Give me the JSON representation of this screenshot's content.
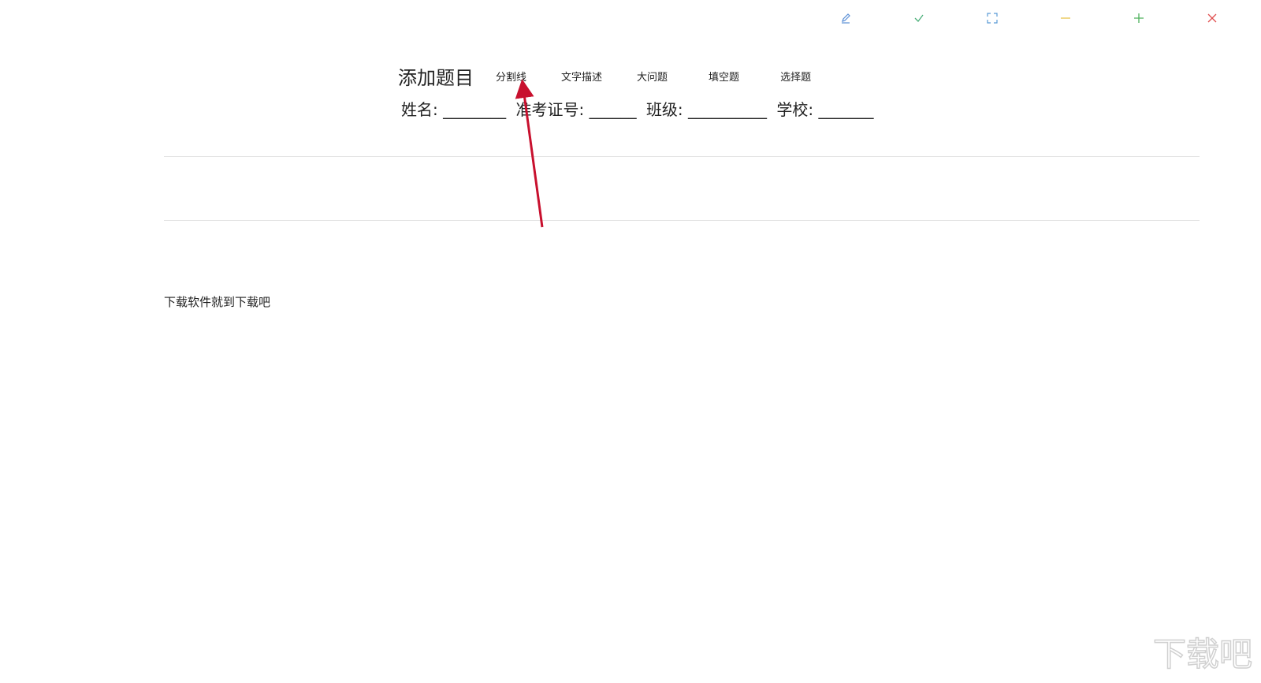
{
  "window_controls": {
    "edit": "pen-icon",
    "confirm": "check-icon",
    "fullscreen": "fullscreen-icon",
    "minimize": "minus-icon",
    "maximize": "plus-icon",
    "close": "close-icon",
    "colors": {
      "edit": "#5b8fd6",
      "confirm": "#4caf7a",
      "fullscreen": "#5b9bd6",
      "minimize": "#e8c34a",
      "maximize": "#4cb05a",
      "close": "#e05050"
    }
  },
  "toolbar": {
    "title": "添加题目",
    "buttons": [
      {
        "label": "分割线"
      },
      {
        "label": "文字描述"
      },
      {
        "label": "大问题"
      },
      {
        "label": "填空题"
      },
      {
        "label": "选择题"
      }
    ]
  },
  "header_info": {
    "name": "姓名: ________",
    "exam_id": "准考证号: ______",
    "class": "班级: __________",
    "school": "学校: _______"
  },
  "content": {
    "description": "下载软件就到下载吧"
  },
  "annotation": {
    "arrow_color": "#c8102e"
  },
  "watermark": {
    "text": "下载吧"
  }
}
